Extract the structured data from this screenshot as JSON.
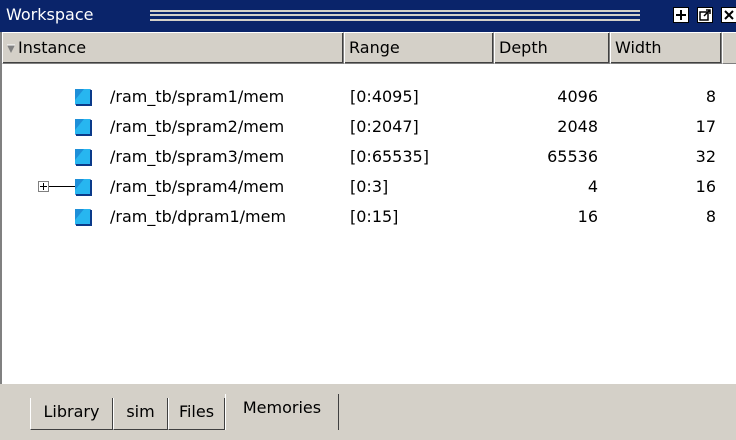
{
  "window": {
    "title": "Workspace"
  },
  "columns": {
    "instance": "Instance",
    "range": "Range",
    "depth": "Depth",
    "width": "Width"
  },
  "rows": [
    {
      "instance": "/ram_tb/spram1/mem",
      "range": "[0:4095]",
      "depth": "4096",
      "width": "8",
      "expandable": false
    },
    {
      "instance": "/ram_tb/spram2/mem",
      "range": "[0:2047]",
      "depth": "2048",
      "width": "17",
      "expandable": false
    },
    {
      "instance": "/ram_tb/spram3/mem",
      "range": "[0:65535]",
      "depth": "65536",
      "width": "32",
      "expandable": false
    },
    {
      "instance": "/ram_tb/spram4/mem",
      "range": "[0:3]",
      "depth": "4",
      "width": "16",
      "expandable": true
    },
    {
      "instance": "/ram_tb/dpram1/mem",
      "range": "[0:15]",
      "depth": "16",
      "width": "8",
      "expandable": false
    }
  ],
  "tabs": [
    {
      "label": "Library",
      "active": false
    },
    {
      "label": "sim",
      "active": false
    },
    {
      "label": "Files",
      "active": false
    },
    {
      "label": "Memories",
      "active": true
    }
  ],
  "icons": {
    "row_icon": "memory-block-icon",
    "expand": "plus-box-icon",
    "title_buttons": [
      "add-icon",
      "undock-icon",
      "close-icon"
    ]
  },
  "colors": {
    "titlebar": "#0a246a",
    "memory_icon": "#1e8fd8"
  }
}
